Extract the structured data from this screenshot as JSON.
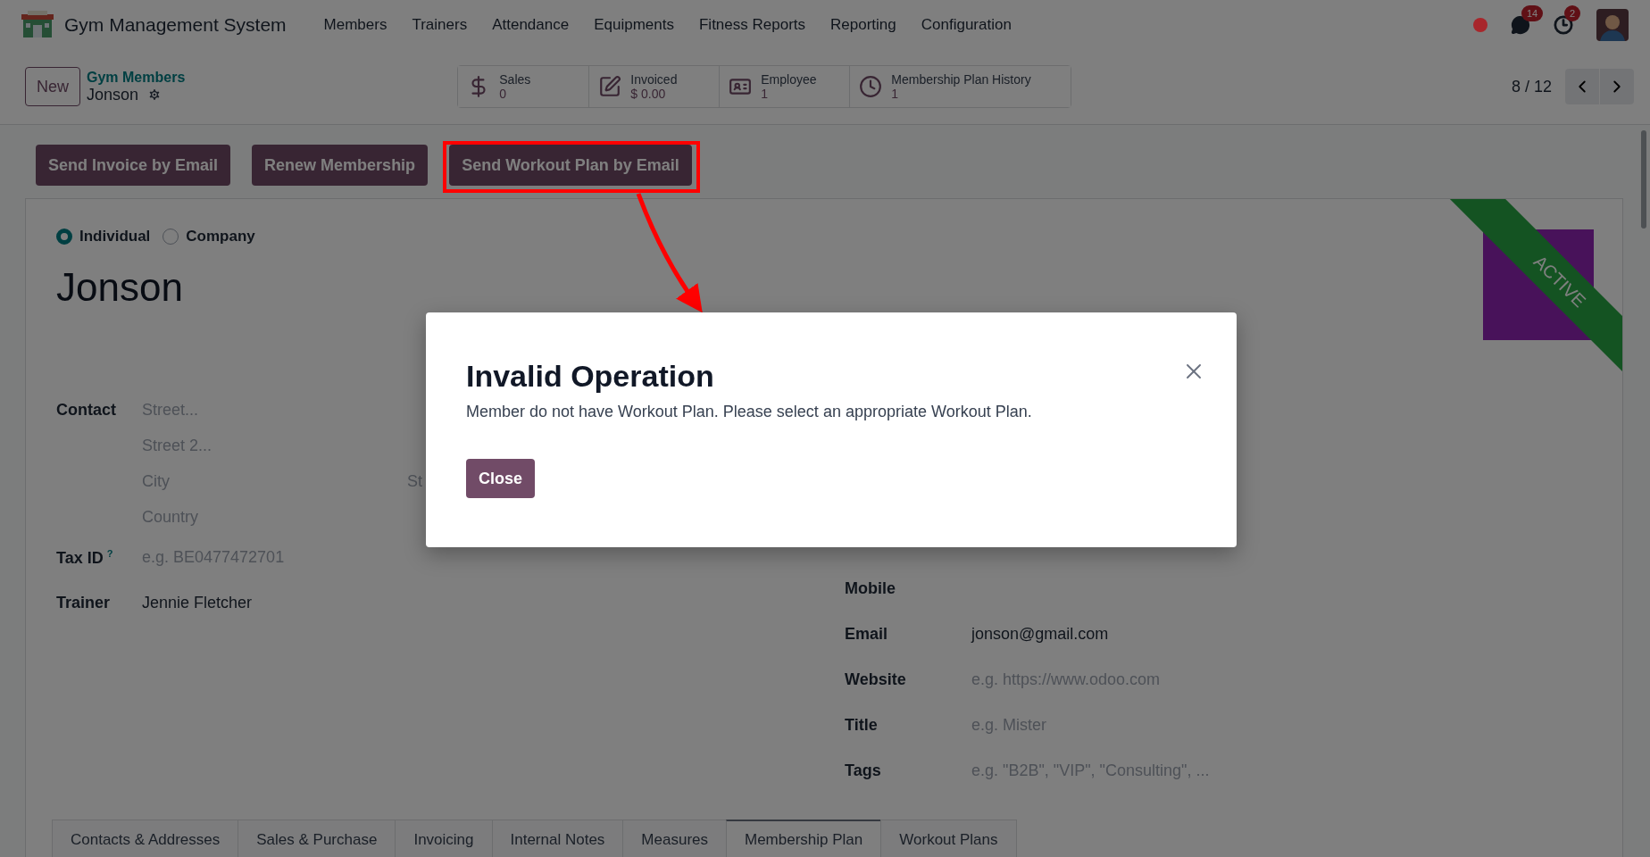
{
  "navbar": {
    "app_name": "Gym Management System",
    "menu": [
      "Members",
      "Trainers",
      "Attendance",
      "Equipments",
      "Fitness Reports",
      "Reporting",
      "Configuration"
    ],
    "systray": [
      {
        "kind": "status",
        "color": "#a8262b"
      },
      {
        "kind": "messages",
        "badge": "14"
      },
      {
        "kind": "activities",
        "badge": "2"
      },
      {
        "kind": "avatar"
      }
    ]
  },
  "control_panel": {
    "new_button": "New",
    "breadcrumb": {
      "parent": "Gym Members",
      "current": "Jonson"
    },
    "stat_buttons": [
      {
        "kind": "dollar",
        "label": "Sales",
        "value": "0"
      },
      {
        "kind": "edit",
        "label": "Invoiced",
        "value": "$ 0.00"
      },
      {
        "kind": "card",
        "label": "Employee",
        "value": "1"
      },
      {
        "kind": "clock",
        "label": "Membership Plan History",
        "value": "1"
      }
    ],
    "pager": "8 / 12"
  },
  "header_buttons": [
    {
      "label": "Send Invoice by Email",
      "highlighted": false
    },
    {
      "label": "Renew Membership",
      "highlighted": false
    },
    {
      "label": "Send Workout Plan by Email",
      "highlighted": true
    }
  ],
  "form": {
    "company_type": [
      {
        "label": "Individual",
        "selected": true
      },
      {
        "label": "Company",
        "selected": false
      }
    ],
    "name": "Jonson",
    "ribbon": "ACTIVE",
    "contact": {
      "label": "Contact",
      "street": "Street...",
      "street2": "Street 2...",
      "city": "City",
      "state": "St",
      "country": "Country"
    },
    "left_fields": [
      {
        "label": "Tax ID",
        "help": "?",
        "placeholder": "e.g. BE0477472701"
      },
      {
        "label": "Trainer",
        "value": "Jennie Fletcher"
      }
    ],
    "right_fields": [
      {
        "label": "Mobile"
      },
      {
        "label": "Email",
        "value": "jonson@gmail.com"
      },
      {
        "label": "Website",
        "placeholder": "e.g. https://www.odoo.com"
      },
      {
        "label": "Title",
        "placeholder": "e.g. Mister"
      },
      {
        "label": "Tags",
        "placeholder": "e.g. \"B2B\", \"VIP\", \"Consulting\", ..."
      }
    ],
    "tabs": [
      {
        "label": "Contacts & Addresses",
        "selected": false
      },
      {
        "label": "Sales & Purchase",
        "selected": false
      },
      {
        "label": "Invoicing",
        "selected": false
      },
      {
        "label": "Internal Notes",
        "selected": false
      },
      {
        "label": "Measures",
        "selected": false
      },
      {
        "label": "Membership Plan",
        "selected": true
      },
      {
        "label": "Workout Plans",
        "selected": false
      }
    ]
  },
  "dialog": {
    "title": "Invalid Operation",
    "message": "Member do not have Workout Plan. Please select an appropriate Workout Plan.",
    "button": "Close"
  }
}
